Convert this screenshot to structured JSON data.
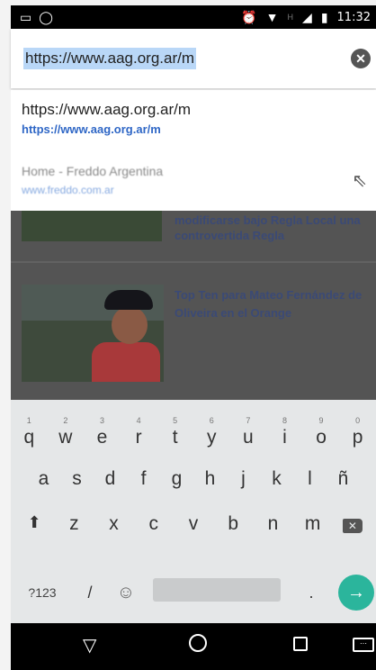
{
  "status_bar": {
    "left_icons": [
      "gallery-icon",
      "whatsapp-icon"
    ],
    "right_icons": [
      "alarm-icon",
      "wifi-icon",
      "signal-icon",
      "battery-icon"
    ],
    "signal_text": "H",
    "time": "11:32"
  },
  "url_bar": {
    "value": "https://www.aag.org.ar/m",
    "clear_icon": "close-icon"
  },
  "suggestions": [
    {
      "title": "https://www.aag.org.ar/m",
      "url": "https://www.aag.org.ar/m"
    },
    {
      "title": "Home - Freddo Argentina",
      "url": "www.freddo.com.ar",
      "icon": "arrow-northwest-icon"
    }
  ],
  "page": {
    "headline_1": "modificarse bajo Regla Local una controvertida Regla",
    "headline_2": "Top Ten para Mateo Fernández de Oliveira en el Orange"
  },
  "keyboard": {
    "row1": [
      "q",
      "w",
      "e",
      "r",
      "t",
      "y",
      "u",
      "i",
      "o",
      "p"
    ],
    "row1_hints": [
      "1",
      "2",
      "3",
      "4",
      "5",
      "6",
      "7",
      "8",
      "9",
      "0"
    ],
    "row2": [
      "a",
      "s",
      "d",
      "f",
      "g",
      "h",
      "j",
      "k",
      "l",
      "ñ"
    ],
    "row3": [
      "z",
      "x",
      "c",
      "v",
      "b",
      "n",
      "m"
    ],
    "sym_label": "?123",
    "slash_label": "/",
    "period_label": ".",
    "enter_icon": "arrow-right-icon",
    "accent_color": "#2bb59c"
  },
  "nav_bar": {
    "icons": [
      "back-icon",
      "home-icon",
      "recents-icon",
      "keyboard-icon"
    ]
  }
}
